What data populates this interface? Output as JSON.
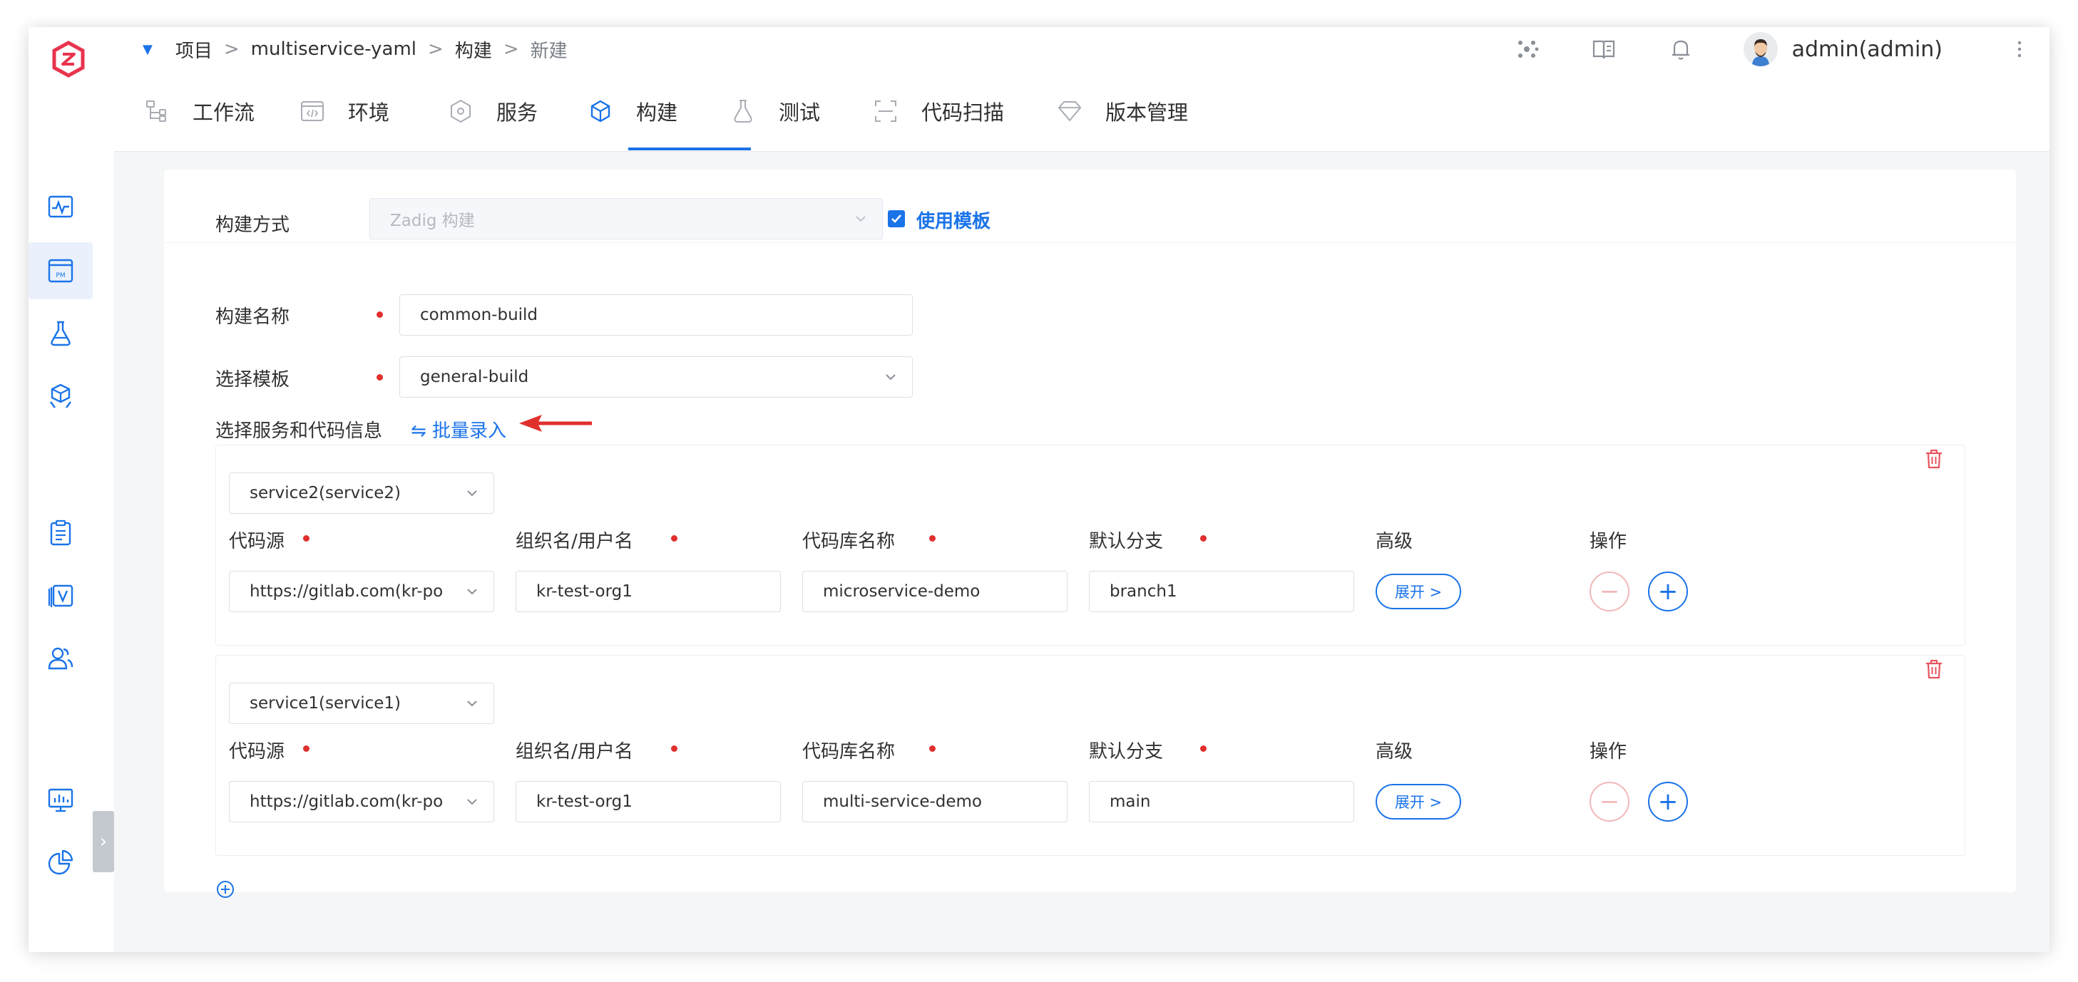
{
  "breadcrumb": {
    "items": [
      "项目",
      "multiservice-yaml",
      "构建",
      "新建"
    ],
    "separator": ">"
  },
  "user": {
    "name": "admin(admin)"
  },
  "tabs": [
    {
      "label": "工作流",
      "icon": "workflow-icon"
    },
    {
      "label": "环境",
      "icon": "environment-icon"
    },
    {
      "label": "服务",
      "icon": "service-icon"
    },
    {
      "label": "构建",
      "icon": "build-icon",
      "active": true
    },
    {
      "label": "测试",
      "icon": "test-icon"
    },
    {
      "label": "代码扫描",
      "icon": "code-scan-icon"
    },
    {
      "label": "版本管理",
      "icon": "version-icon"
    }
  ],
  "form": {
    "build_method_label": "构建方式",
    "build_method_value": "Zadig 构建",
    "use_template_label": "使用模板",
    "use_template_checked": true,
    "build_name_label": "构建名称",
    "build_name_value": "common-build",
    "template_label": "选择模板",
    "template_value": "general-build",
    "services_label": "选择服务和代码信息",
    "batch_entry_label": "⇋ 批量录入"
  },
  "columns": {
    "source": "代码源",
    "org": "组织名/用户名",
    "repo": "代码库名称",
    "branch": "默认分支",
    "advanced": "高级",
    "actions": "操作"
  },
  "services": [
    {
      "service": "service2(service2)",
      "source": "https://gitlab.com(kr-po",
      "org": "kr-test-org1",
      "repo": "microservice-demo",
      "branch": "branch1",
      "expand_label": "展开 >"
    },
    {
      "service": "service1(service1)",
      "source": "https://gitlab.com(kr-po",
      "org": "kr-test-org1",
      "repo": "multi-service-demo",
      "branch": "main",
      "expand_label": "展开 >"
    }
  ],
  "symbols": {
    "minus": "−",
    "plus": "+"
  },
  "colors": {
    "primary": "#1a73e8",
    "required": "#e0302e",
    "danger": "#e8545f",
    "logo": "#e8344e"
  }
}
